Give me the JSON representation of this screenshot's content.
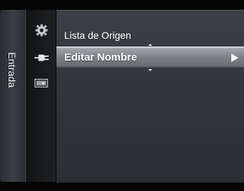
{
  "sidebar": {
    "label": "Entrada"
  },
  "icons": [
    {
      "name": "gear-icon"
    },
    {
      "name": "plug-icon",
      "selected": true
    },
    {
      "name": "input-icon"
    }
  ],
  "menu": {
    "items": [
      {
        "label": "Lista de Origen"
      },
      {
        "label": "Editar Nombre",
        "selected": true
      }
    ]
  },
  "colors": {
    "panel": "#33373b",
    "highlight": "#7d8185",
    "text": "#ffffff"
  }
}
